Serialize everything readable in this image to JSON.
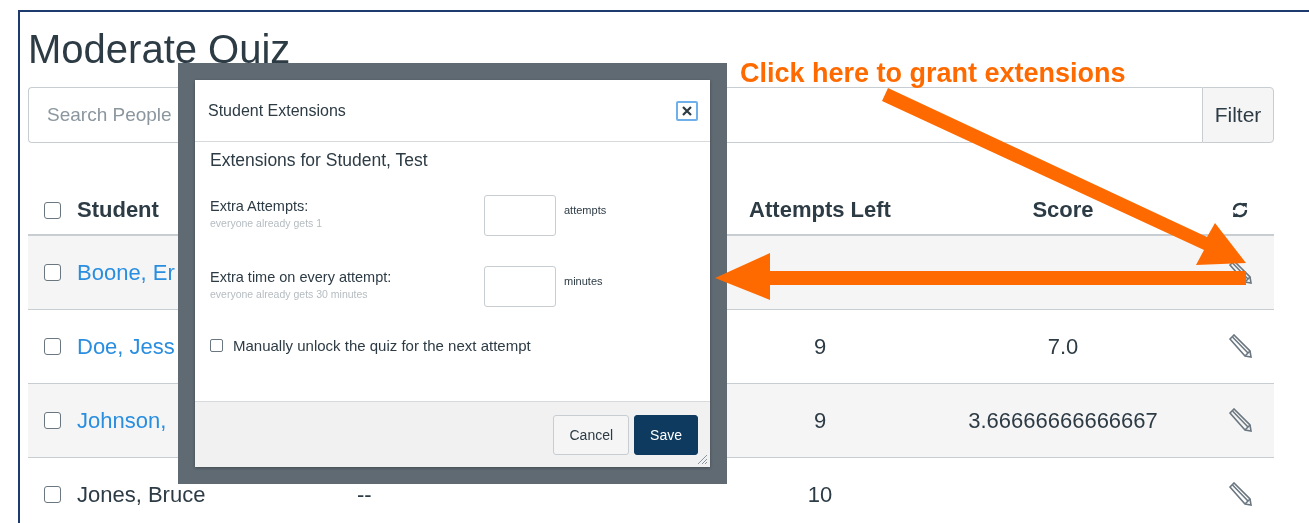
{
  "page": {
    "title": "Moderate Quiz"
  },
  "search": {
    "placeholder": "Search People"
  },
  "filter_button": {
    "label": "Filter"
  },
  "table": {
    "header": {
      "checked": false,
      "student": "Student",
      "attempts_left": "Attempts Left",
      "score": "Score"
    },
    "rows": [
      {
        "name": "Boone, Er",
        "link": true,
        "checked": false
      },
      {
        "name": "Doe, Jess",
        "link": true,
        "checked": false,
        "attempts_left": "9",
        "score": "7.0"
      },
      {
        "name": "Johnson,",
        "link": true,
        "checked": false,
        "attempts_left": "9",
        "score": "3.66666666666667"
      },
      {
        "name": "Jones, Bruce",
        "link": false,
        "checked": false,
        "column_3": "--",
        "attempts_left": "10"
      }
    ]
  },
  "dialog": {
    "title": "Student Extensions",
    "subtitle": "Extensions for Student, Test",
    "fields": [
      {
        "label": "Extra Attempts:",
        "hint": "everyone already gets 1",
        "unit": "attempts"
      },
      {
        "label": "Extra time on every attempt:",
        "hint": "everyone already gets 30 minutes",
        "unit": "minutes"
      }
    ],
    "unlock": {
      "label": "Manually unlock the quiz for the next attempt",
      "checked": false
    },
    "buttons": [
      {
        "label": "Cancel",
        "kind": "secondary"
      },
      {
        "label": "Save",
        "kind": "primary"
      }
    ]
  },
  "annotation": {
    "text": "Click here to grant extensions"
  }
}
